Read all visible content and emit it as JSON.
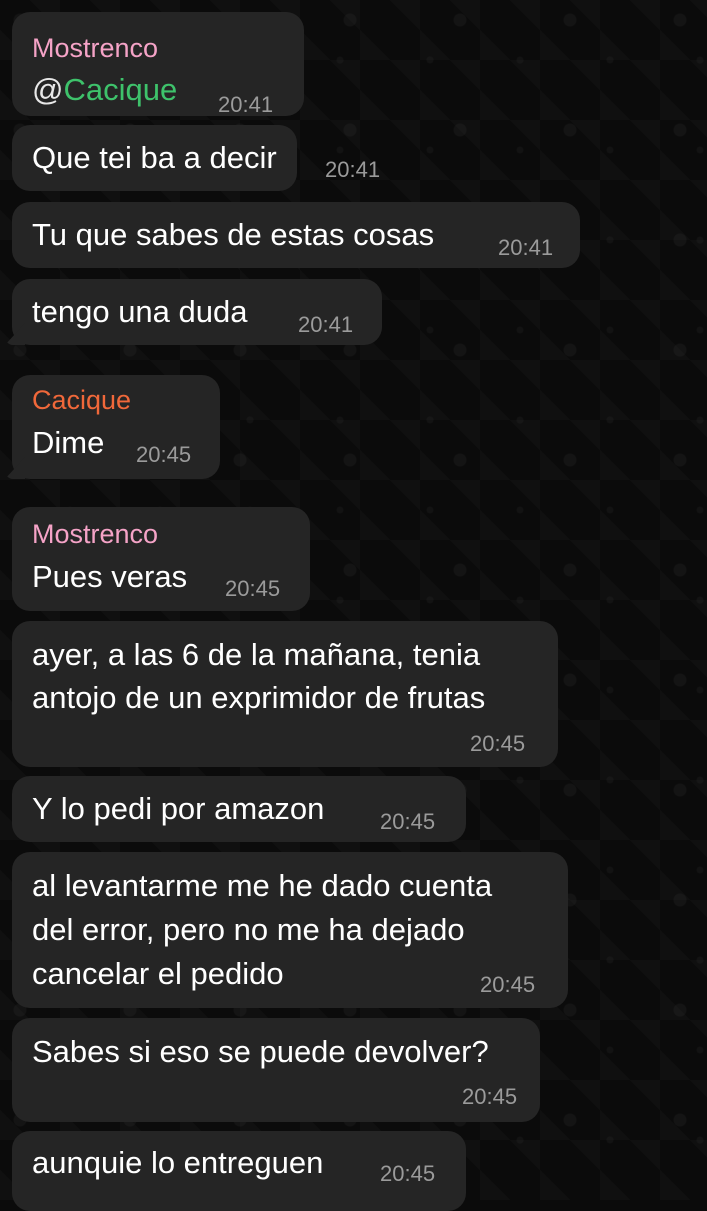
{
  "colors": {
    "background": "#0b0b0b",
    "bubble": "#252525",
    "text": "#ffffff",
    "time": "#9b9b9b",
    "sender_mostrenco": "#f5a3c7",
    "sender_cacique": "#f0683a",
    "mention": "#3ec26b"
  },
  "messages": [
    {
      "sender": "Mostrenco",
      "mention_prefix": "@",
      "mention": "Cacique",
      "time": "20:41"
    },
    {
      "text": "Que tei ba a decir",
      "time": "20:41"
    },
    {
      "text": "Tu que sabes de estas cosas",
      "time": "20:41"
    },
    {
      "text": "tengo una duda",
      "time": "20:41"
    },
    {
      "sender": "Cacique",
      "text": "Dime",
      "time": "20:45"
    },
    {
      "sender": "Mostrenco",
      "text": "Pues veras",
      "time": "20:45"
    },
    {
      "lines": [
        "ayer, a las 6 de la mañana, tenia",
        "antojo de un exprimidor de frutas"
      ],
      "time": "20:45"
    },
    {
      "text": "Y lo pedi por amazon",
      "time": "20:45"
    },
    {
      "lines": [
        "al levantarme me he dado cuenta",
        "del error, pero no me ha dejado",
        "cancelar el pedido"
      ],
      "time": "20:45"
    },
    {
      "text": "Sabes si eso se puede devolver?",
      "time": "20:45"
    },
    {
      "text": "aunquie lo entreguen",
      "time": "20:45"
    }
  ]
}
